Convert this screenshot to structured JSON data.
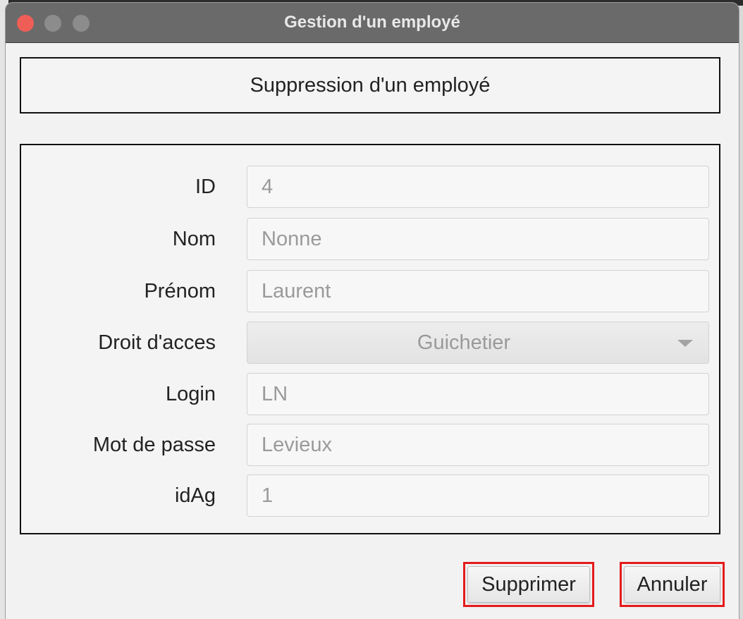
{
  "window": {
    "title": "Gestion d'un employé"
  },
  "header": {
    "title": "Suppression d'un employé"
  },
  "form": {
    "fields": [
      {
        "label": "ID",
        "value": "4"
      },
      {
        "label": "Nom",
        "value": "Nonne"
      },
      {
        "label": "Prénom",
        "value": "Laurent"
      },
      {
        "label": "Droit d'acces",
        "value": "Guichetier",
        "type": "select"
      },
      {
        "label": "Login",
        "value": "LN"
      },
      {
        "label": "Mot de passe",
        "value": "Levieux"
      },
      {
        "label": "idAg",
        "value": "1"
      }
    ]
  },
  "buttons": {
    "delete_label": "Supprimer",
    "cancel_label": "Annuler"
  },
  "colors": {
    "highlight": "#e41b1b",
    "close": "#ee5e57",
    "titlebar": "#6a6a6a"
  }
}
